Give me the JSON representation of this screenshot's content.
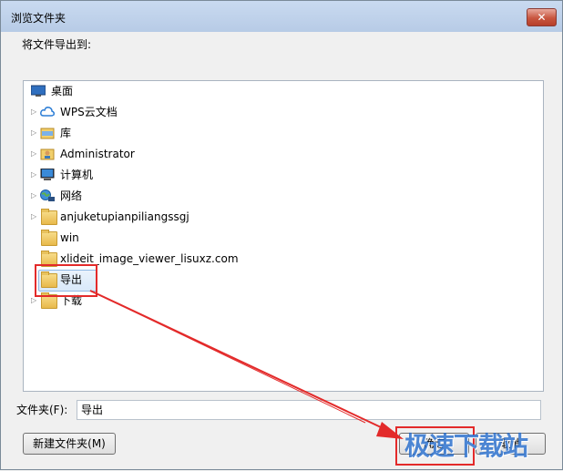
{
  "window": {
    "title": "浏览文件夹",
    "close_glyph": "✕"
  },
  "prompt": "将文件导出到:",
  "tree": {
    "items": [
      {
        "label": "桌面",
        "icon": "desktop-icon"
      },
      {
        "label": "WPS云文档",
        "icon": "cloud-icon"
      },
      {
        "label": "库",
        "icon": "library-icon"
      },
      {
        "label": "Administrator",
        "icon": "user-folder-icon"
      },
      {
        "label": "计算机",
        "icon": "computer-icon"
      },
      {
        "label": "网络",
        "icon": "network-icon"
      },
      {
        "label": "anjuketupianpiliangssgj",
        "icon": "folder-icon"
      },
      {
        "label": "win",
        "icon": "folder-icon"
      },
      {
        "label": "xlideit_image_viewer_lisuxz.com",
        "icon": "folder-icon"
      },
      {
        "label": "导出",
        "icon": "folder-icon",
        "selected": true
      },
      {
        "label": "下载",
        "icon": "folder-icon"
      }
    ]
  },
  "folder_field": {
    "label": "文件夹(F):",
    "value": "导出"
  },
  "buttons": {
    "new_folder": "新建文件夹(M)",
    "ok": "确定",
    "cancel": "取消"
  },
  "watermark": "极速下载站",
  "colors": {
    "annotation_red": "#e32a2a",
    "selection_blue": "#d9e9f9"
  }
}
